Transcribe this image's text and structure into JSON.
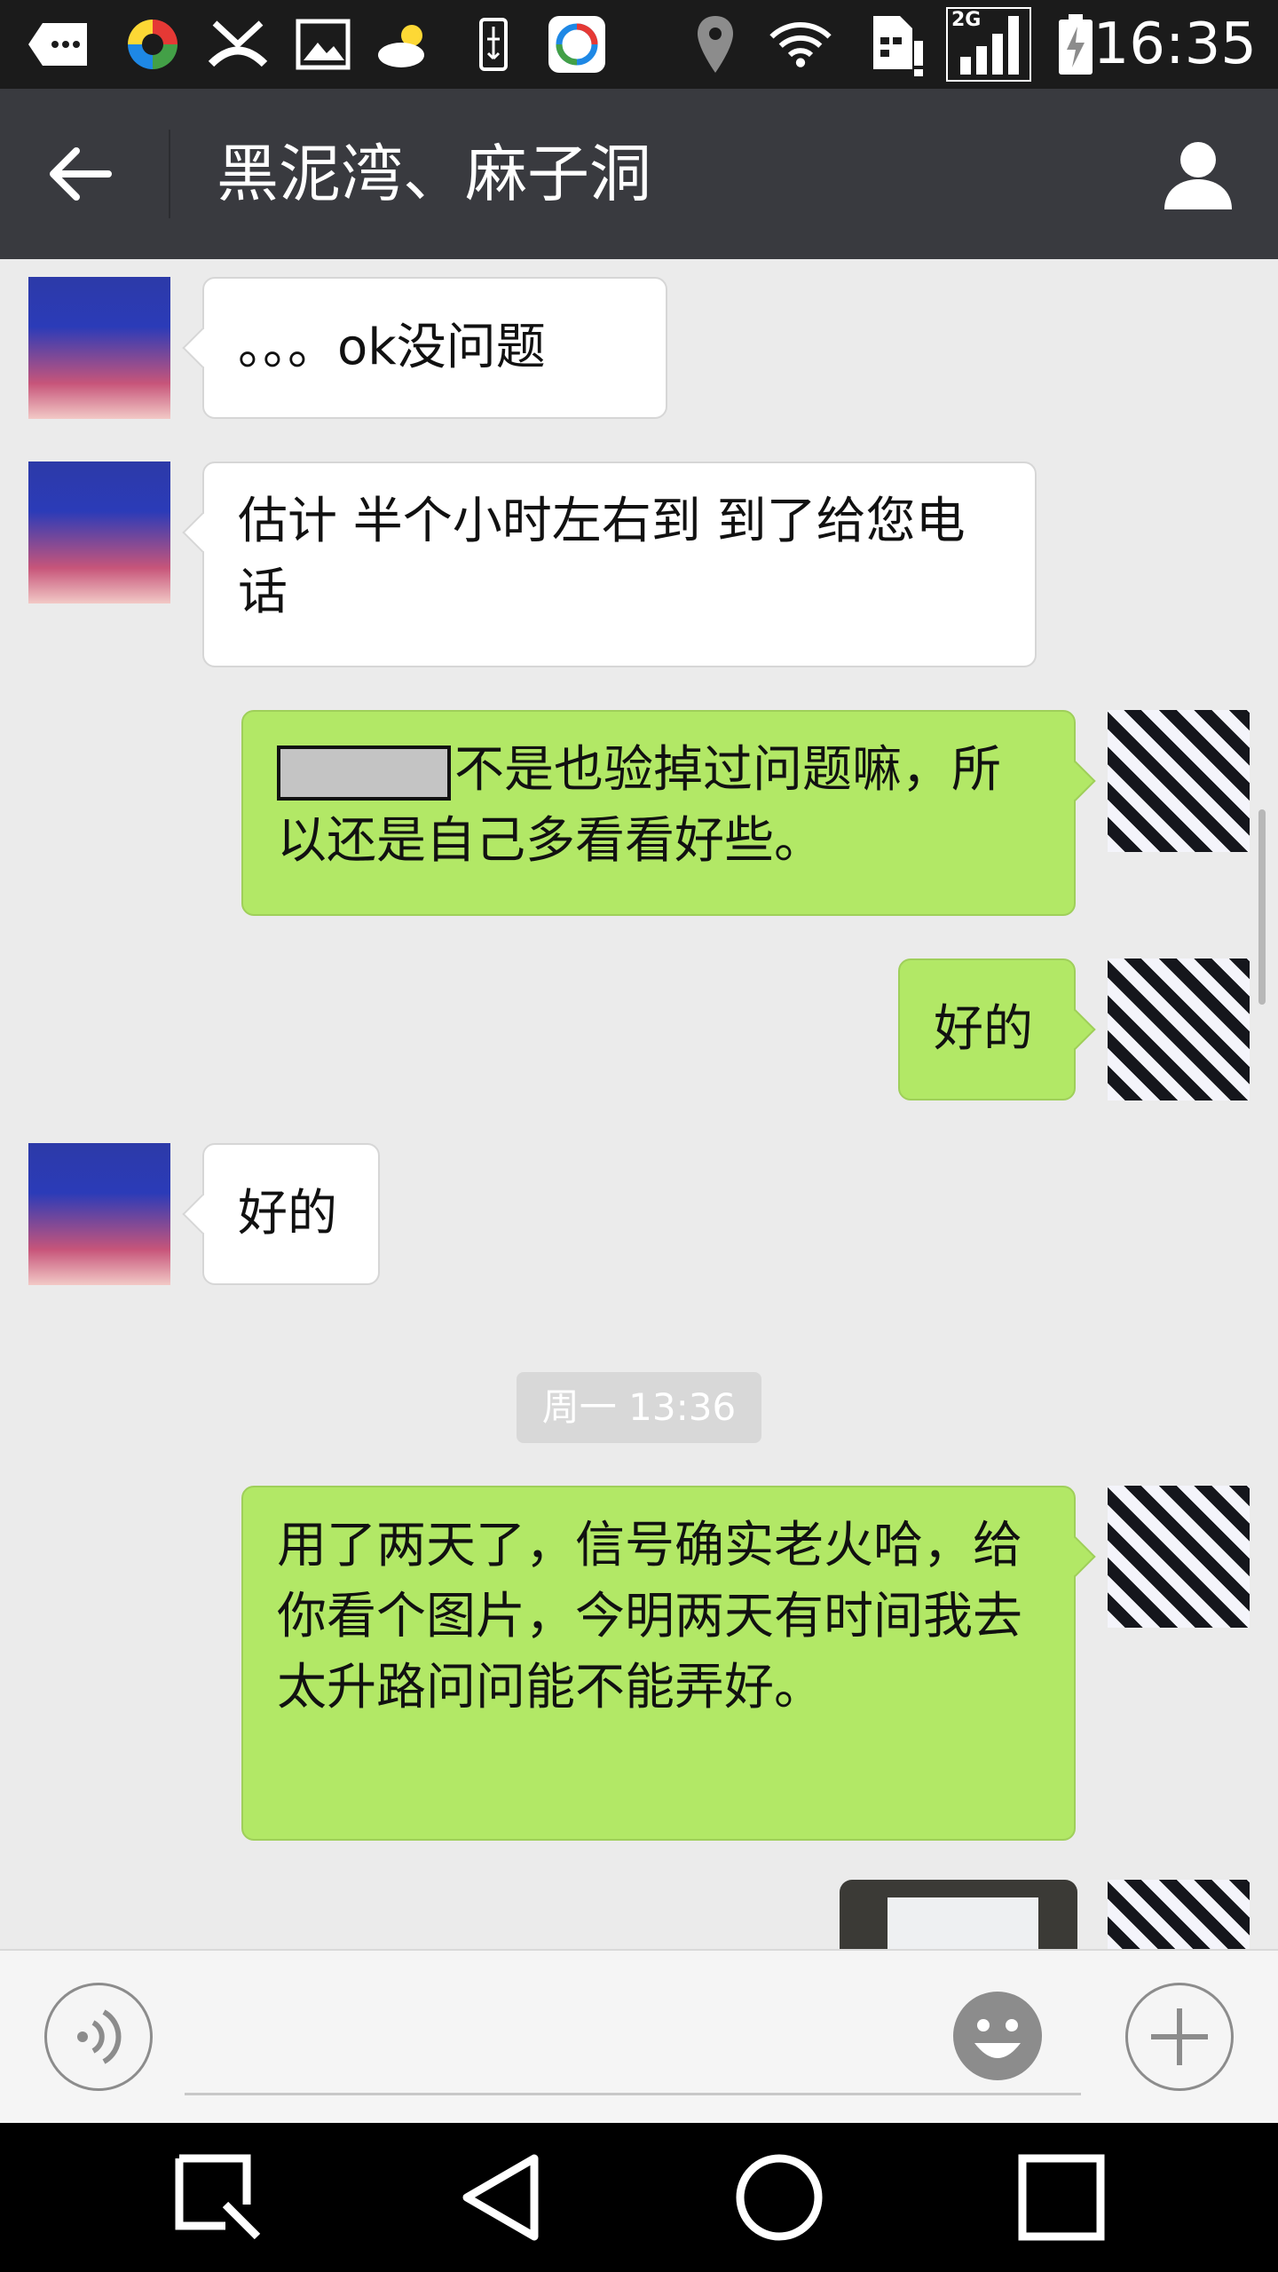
{
  "status_bar": {
    "time": "16:35",
    "network_label": "2G",
    "icons": [
      "message-dots-icon",
      "color-app-icon",
      "missed-call-icon",
      "image-icon",
      "weather-icon",
      "usb-icon",
      "browser-app-icon",
      "location-icon",
      "wifi-icon",
      "sim-alert-icon",
      "signal-icon",
      "battery-charging-icon"
    ]
  },
  "header": {
    "title": "黑泥湾、麻子洞",
    "back_icon": "arrow-left-icon",
    "profile_icon": "person-icon"
  },
  "messages": [
    {
      "side": "left",
      "text": "。。。ok没问题"
    },
    {
      "side": "left",
      "text": "估计  半个小时左右到 到了给您电话"
    },
    {
      "side": "right",
      "text": "不是也验掉过问题嘛，所以还是自己多看看好些。",
      "redacted_prefix": true
    },
    {
      "side": "right",
      "text": "好的"
    },
    {
      "side": "left",
      "text": "好的"
    },
    {
      "side": "right",
      "text": "用了两天了，信号确实老火哈，给你看个图片，今明两天有时间我去太升路问问能不能弄好。"
    },
    {
      "side": "right",
      "type": "image"
    }
  ],
  "timestamp": "周一 13:36",
  "input_bar": {
    "voice_icon": "voice-icon",
    "emoji_icon": "emoji-icon",
    "plus_icon": "plus-icon",
    "text_value": ""
  },
  "nav_bar": {
    "icons": [
      "search-square-icon",
      "back-triangle-icon",
      "home-circle-icon",
      "recents-square-icon"
    ]
  },
  "colors": {
    "title_bar": "#393a3f",
    "chat_bg": "#ebebeb",
    "self_bubble": "#b2e866",
    "other_bubble": "#ffffff"
  }
}
